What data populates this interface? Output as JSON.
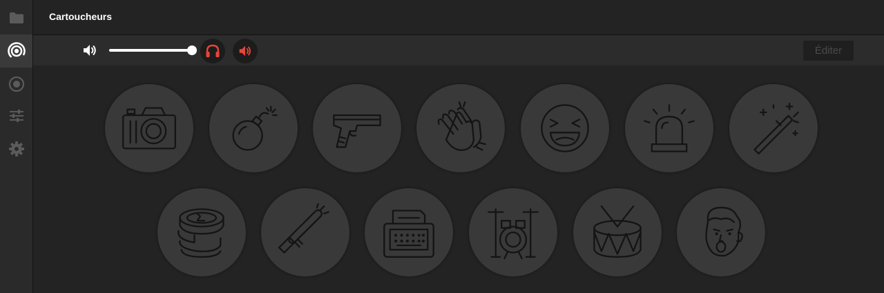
{
  "app": {
    "title": "Cartoucheurs"
  },
  "sidebar": {
    "items": [
      {
        "icon": "folder-icon",
        "active": false
      },
      {
        "icon": "broadcast-icon",
        "active": true
      },
      {
        "icon": "record-icon",
        "active": false
      },
      {
        "icon": "sliders-icon",
        "active": false
      },
      {
        "icon": "gear-icon",
        "active": false
      }
    ]
  },
  "toolbar": {
    "volume_icon": "volume-icon",
    "volume_level": 1.0,
    "headphones_icon": "headphones-icon",
    "speaker_icon": "speaker-icon",
    "edit_label": "Éditer"
  },
  "colors": {
    "background": "#232323",
    "sidebar": "#2a2a2a",
    "accent": "#e8463a",
    "pad": "#393939"
  },
  "pads": [
    {
      "icon": "camera-icon"
    },
    {
      "icon": "bomb-icon"
    },
    {
      "icon": "pistol-icon"
    },
    {
      "icon": "clapping-hands-icon"
    },
    {
      "icon": "laughing-face-icon"
    },
    {
      "icon": "siren-icon"
    },
    {
      "icon": "magic-wand-icon"
    },
    {
      "icon": "coins-icon"
    },
    {
      "icon": "lightsaber-icon"
    },
    {
      "icon": "typewriter-icon"
    },
    {
      "icon": "drum-kit-icon"
    },
    {
      "icon": "snare-drum-icon"
    },
    {
      "icon": "surprised-face-icon"
    }
  ]
}
